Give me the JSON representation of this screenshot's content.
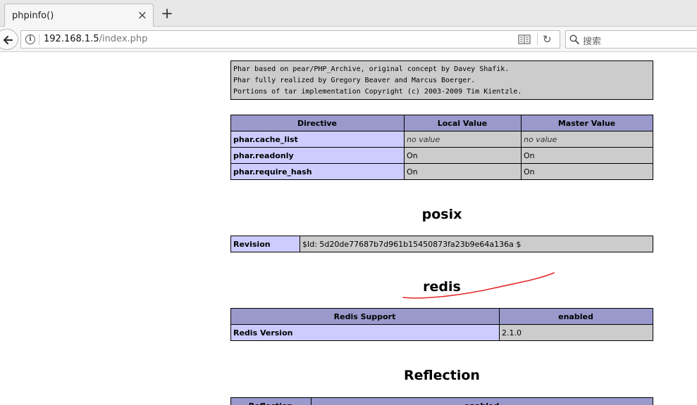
{
  "browser": {
    "tab_title": "phpinfo()",
    "tab_close": "×",
    "new_tab": "+",
    "url_host": "192.168.1.5",
    "url_path": "/index.php",
    "search_placeholder": "搜索",
    "reload_glyph": "↻"
  },
  "phar_credits": [
    "Phar based on pear/PHP_Archive, original concept by Davey Shafik.",
    "Phar fully realized by Gregory Beaver and Marcus Boerger.",
    "Portions of tar implementation Copyright (c) 2003-2009 Tim Kientzle."
  ],
  "phar_table": {
    "headers": [
      "Directive",
      "Local Value",
      "Master Value"
    ],
    "rows": [
      [
        "phar.cache_list",
        "no value",
        "no value"
      ],
      [
        "phar.readonly",
        "On",
        "On"
      ],
      [
        "phar.require_hash",
        "On",
        "On"
      ]
    ]
  },
  "posix": {
    "heading": "posix",
    "revision_label": "Revision",
    "revision_value": "$Id: 5d20de77687b7d961b15450873fa23b9e64a136a $"
  },
  "redis": {
    "heading": "redis",
    "headers": [
      "Redis Support",
      "enabled"
    ],
    "version_label": "Redis Version",
    "version_value": "2.1.0"
  },
  "reflection": {
    "heading": "Reflection",
    "headers": [
      "Reflection",
      "enabled"
    ]
  },
  "colors": {
    "header_bg": "#9999cc",
    "label_bg": "#ccccff",
    "value_bg": "#cccccc",
    "annotation_stroke": "#e8262a"
  }
}
